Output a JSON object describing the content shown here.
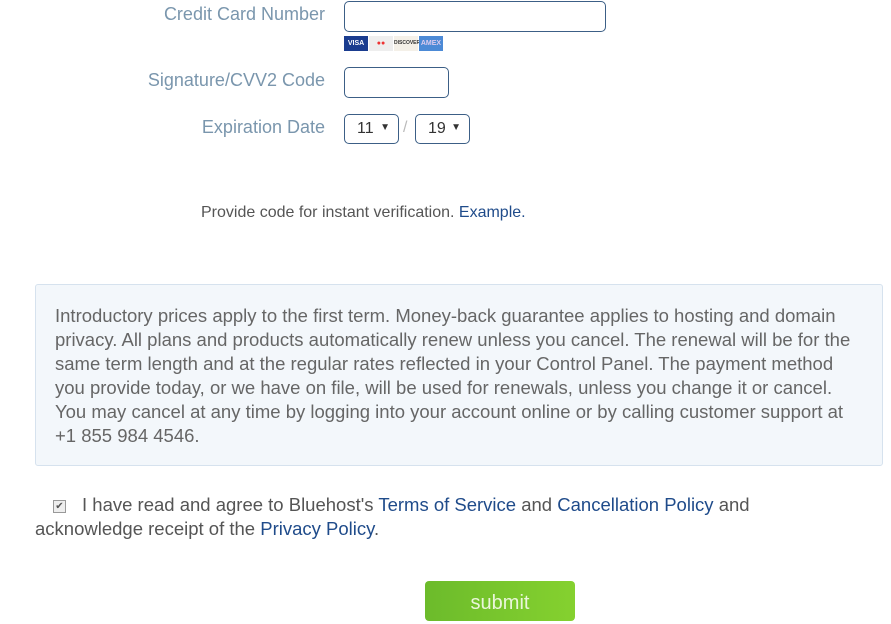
{
  "form": {
    "cc_label": "Credit Card Number",
    "cc_value": "",
    "cards": [
      "VISA",
      "MC",
      "DISCOVER",
      "AMEX"
    ],
    "cvv_label": "Signature/CVV2 Code",
    "cvv_value": "",
    "exp_label": "Expiration Date",
    "exp_month": "11",
    "exp_sep": "/",
    "exp_year": "19",
    "note_text": "Provide code for instant verification. ",
    "note_link": "Example."
  },
  "info": "Introductory prices apply to the first term. Money-back guarantee applies to hosting and domain privacy. All plans and products automatically renew unless you cancel. The renewal will be for the same term length and at the regular rates reflected in your Control Panel. The payment method you provide today, or we have on file, will be used for renewals, unless you change it or cancel. You may cancel at any time by logging into your account online or by calling customer support at +1 855 984 4546.",
  "agree": {
    "checked": true,
    "t1": "I have read and agree to Bluehost's ",
    "tos": "Terms of Service",
    "t2": " and ",
    "cancel": "Cancellation Policy",
    "t3": " and acknowledge receipt of the ",
    "privacy": "Privacy Policy",
    "t4": "."
  },
  "submit_label": "submit"
}
